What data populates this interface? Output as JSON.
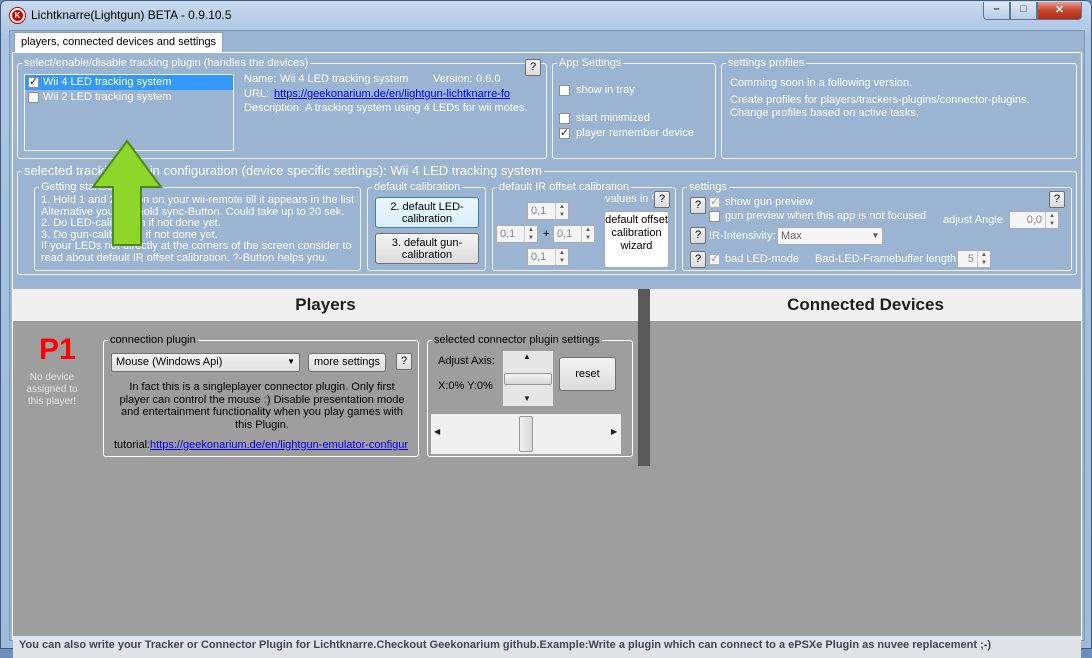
{
  "window": {
    "title": "Lichtknarre(Lightgun) BETA - 0.9.10.5",
    "icon": "app-logo-icon",
    "min": "–",
    "max": "□",
    "close": "✕"
  },
  "tab": {
    "label": "players, connected devices and settings"
  },
  "tracking": {
    "legend": "select/enable/disable tracking plugin (handles the devices)",
    "items": [
      {
        "label": "Wii 4 LED tracking system",
        "checked": true,
        "selected": true
      },
      {
        "label": "Wii 2 LED tracking system",
        "checked": false,
        "selected": false
      }
    ],
    "name_label": "Name:",
    "name": "Wii 4 LED tracking system",
    "version_label": "Version:",
    "version": "0.6.0",
    "url_label": "URL:",
    "url": "https://geekonarium.de/en/lightgun-lichtknarre-fo",
    "desc_label": "Description:",
    "desc": "A tracking system using 4 LEDs for wii motes.",
    "help": "?"
  },
  "app_settings": {
    "legend": "App Settings",
    "show_tray": "show in tray",
    "start_min": "start minimized",
    "remember": "player remember device"
  },
  "profiles": {
    "legend": "settings profiles",
    "line1": "Comming soon in a following version.",
    "line2": "Create profiles for players/trackers-plugins/connector-plugins.",
    "line3": "Change profiles based on active tasks."
  },
  "config": {
    "legend": "selected tracking plugin configuration (device specific settings): Wii 4 LED tracking system",
    "getting_started": {
      "legend": "Getting started",
      "l1": "1. Hold 1 and 2 button on your wii-remote till it appears in the list.",
      "l2": "Alternative you can hold sync-Button. Could take up to 20 sek.",
      "l3": "2. Do LED-calibration if not done yet.",
      "l4": "3. Do gun-calibration if not done yet.",
      "l5": "If your LEDs not directly at the corners of the screen consider to",
      "l6": "read about default IR offset calibration. ?-Button helps you."
    },
    "default_cal": {
      "legend": "default calibration",
      "led": "2. default LED-calibration",
      "gun": "3. default gun-calibration"
    },
    "ir_offset": {
      "legend": "default IR offset calibration",
      "values_in": "values in %",
      "v_top": "0,1",
      "v_left": "0,1",
      "v_right": "0,1",
      "v_bottom": "0,1",
      "plus": "+",
      "wizard": "default offset calibration wizard",
      "help": "?"
    },
    "settings": {
      "legend": "settings",
      "show_preview": "show gun preview",
      "preview_unfocused": "gun preview when this app is not focused",
      "adjust_angle": "adjust Angle:",
      "angle": "0,0",
      "ir_label": "IR-Intensivity:",
      "ir_value": "Max",
      "bad_led": "bad LED-mode",
      "bad_led_buf": "Bad-LED-Framebuffer length:",
      "buf_value": "5",
      "help": "?"
    }
  },
  "players": {
    "header": "Players",
    "p_label": "P1",
    "no_device": "No device assigned to this player!"
  },
  "devices": {
    "header": "Connected Devices"
  },
  "connection": {
    "legend": "connection plugin",
    "selected": "Mouse (Windows Api)",
    "more": "more settings",
    "help": "?",
    "desc": "In fact this is a singleplayer connector plugin. Only first player can control the mouse :) Disable presentation mode and entertainment functionality when you play games with this Plugin.",
    "tutorial_label": "tutorial:",
    "tutorial_url": "https://geekonarium.de/en/lightgun-emulator-configur"
  },
  "connector_settings": {
    "legend": "selected connector plugin settings",
    "adjust_axis": "Adjust Axis:",
    "xy": "X:0% Y:0%",
    "reset": "reset"
  },
  "status": {
    "text": "You can also write your Tracker or Connector Plugin for Lichtknarre.Checkout Geekonarium github.Example:Write a plugin which can connect to a ePSXe Plugin as nuvee replacement ;-)"
  },
  "colors": {
    "accent_red": "#ff0000",
    "arrow_green": "#8fd62a",
    "panel_bg": "#9ab4d1",
    "dark_panel": "#9e9e9e"
  }
}
